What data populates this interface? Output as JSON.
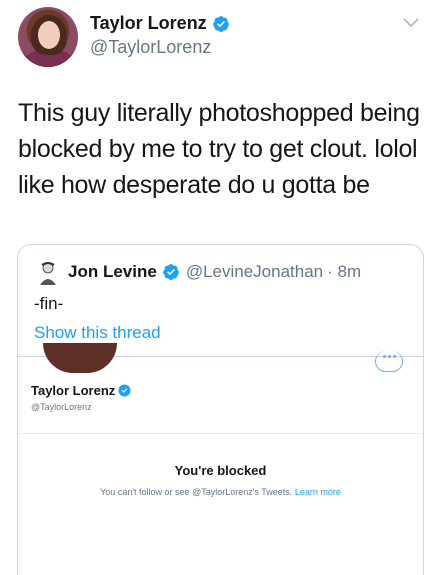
{
  "tweet": {
    "author_name": "Taylor Lorenz",
    "author_handle": "@TaylorLorenz",
    "text": "This guy literally photoshopped being blocked by me to try to get clout. lolol like how desperate do u gotta be",
    "icons": {
      "verified": "verified-badge-icon",
      "menu": "chevron-down-icon"
    }
  },
  "quote": {
    "author_name": "Jon Levine",
    "author_handle": "@LevineJonathan",
    "time": "· 8m",
    "text": "-fin-",
    "show_thread": "Show this thread",
    "image": {
      "profile_name": "Taylor Lorenz",
      "profile_handle": "@TaylorLorenz",
      "blocked_title": "You're blocked",
      "blocked_text": "You can't follow or see @TaylorLorenz's Tweets.",
      "learn_more": "Learn more"
    }
  },
  "colors": {
    "link": "#1da1f2",
    "verified": "#1da1f2",
    "muted": "#657786",
    "text": "#14171a",
    "border": "#ccd6dd"
  }
}
